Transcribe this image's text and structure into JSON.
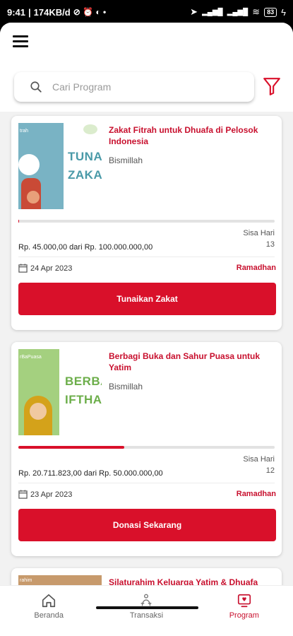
{
  "status_bar": {
    "time": "9:41",
    "net_speed": "174KB/d",
    "battery": "83"
  },
  "header": {
    "search_placeholder": "Cari Program"
  },
  "programs": [
    {
      "title": "Zakat Fitrah untuk Dhuafa di Pelosok Indonesia",
      "description": "Bismillah",
      "thumb_text_top": "trah",
      "thumb_text_big_1": "TUNAIK",
      "thumb_text_big_2": "ZAKAT",
      "progress": 0.00045,
      "amount": "Rp. 45.000,00 dari Rp. 100.000.000,00",
      "remaining_label": "Sisa Hari",
      "remaining_days": "13",
      "date": "24 Apr 2023",
      "category": "Ramadhan",
      "action": "Tunaikan Zakat"
    },
    {
      "title": "Berbagi Buka dan Sahur Puasa untuk Yatim",
      "description": "Bismillah",
      "thumb_text_top": "rBaPuasa",
      "thumb_text_big_1": "BERBA",
      "thumb_text_big_2": "IFTHA",
      "progress": 0.414,
      "amount": "Rp. 20.711.823,00 dari Rp. 50.000.000,00",
      "remaining_label": "Sisa Hari",
      "remaining_days": "12",
      "date": "23 Apr 2023",
      "category": "Ramadhan",
      "action": "Donasi Sekarang"
    },
    {
      "title": "Silaturahim Keluarga Yatim & Dhuafa",
      "thumb_text_top": "rahim"
    }
  ],
  "bottom_nav": [
    {
      "label": "Beranda",
      "icon": "home-icon"
    },
    {
      "label": "Transaksi",
      "icon": "transaction-icon"
    },
    {
      "label": "Program",
      "icon": "program-icon"
    }
  ],
  "colors": {
    "accent": "#d9102a",
    "title_red": "#c8102e",
    "thumb_blue": "#79b3c4",
    "thumb_green": "#a4d07f"
  }
}
